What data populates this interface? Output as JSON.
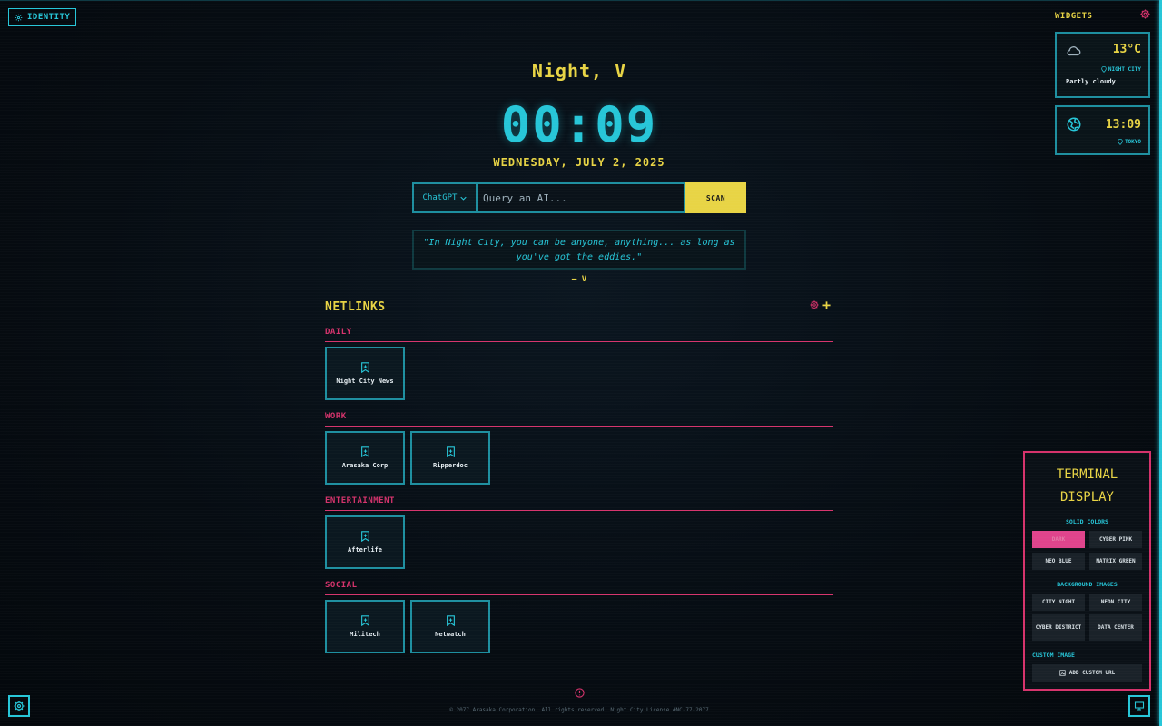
{
  "identity": {
    "label": "IDENTITY"
  },
  "greeting": "Night, V",
  "clock": "00:09",
  "date": "WEDNESDAY, JULY 2, 2025",
  "search": {
    "engine": "ChatGPT",
    "placeholder": "Query an AI...",
    "button": "SCAN"
  },
  "quote": {
    "text": "\"In Night City, you can be anyone, anything... as long as you've got the eddies.\"",
    "author": "– V"
  },
  "netlinks": {
    "title": "NETLINKS",
    "categories": [
      {
        "name": "DAILY",
        "links": [
          "Night City News"
        ]
      },
      {
        "name": "WORK",
        "links": [
          "Arasaka Corp",
          "Ripperdoc"
        ]
      },
      {
        "name": "ENTERTAINMENT",
        "links": [
          "Afterlife"
        ]
      },
      {
        "name": "SOCIAL",
        "links": [
          "Militech",
          "Netwatch"
        ]
      }
    ]
  },
  "widgets": {
    "title": "WIDGETS",
    "weather": {
      "temp": "13°C",
      "location": "NIGHT CITY",
      "description": "Partly cloudy",
      "icon": "cloud-icon"
    },
    "worldclock": {
      "time": "13:09",
      "location": "TOKYO",
      "icon": "globe-icon"
    }
  },
  "terminal": {
    "title_line1": "TERMINAL",
    "title_line2": "DISPLAY",
    "solid_colors_label": "SOLID COLORS",
    "solid_colors": [
      "DARK",
      "CYBER PINK",
      "NEO BLUE",
      "MATRIX GREEN"
    ],
    "bg_images_label": "BACKGROUND IMAGES",
    "bg_images": [
      "CITY NIGHT",
      "NEON CITY",
      "CYBER DISTRICT",
      "DATA CENTER"
    ],
    "custom_label": "CUSTOM IMAGE",
    "custom_button": "ADD CUSTOM URL"
  },
  "footer": {
    "copyright": "© 2077 Arasaka Corporation. All rights reserved. Night City License #NC-77-2077"
  },
  "colors": {
    "cyan": "#27c6d8",
    "yellow": "#e8d445",
    "pink": "#d6336c",
    "background": "#060c12"
  }
}
